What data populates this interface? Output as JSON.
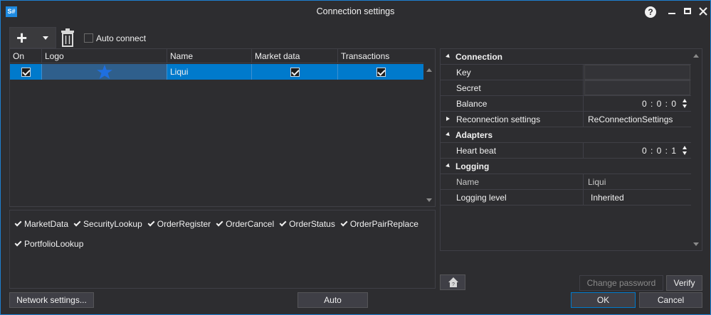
{
  "window": {
    "title": "Connection settings",
    "app_icon_text": "S#"
  },
  "toolbar": {
    "add_icon": "plus-icon",
    "dropdown_icon": "caret-down-icon",
    "delete_icon": "trash-icon",
    "auto_connect_label": "Auto connect",
    "auto_connect_checked": false
  },
  "grid": {
    "columns": [
      "On",
      "Logo",
      "Name",
      "Market data",
      "Transactions"
    ],
    "rows": [
      {
        "on": true,
        "logo_icon": "star-icon",
        "name": "Liqui",
        "market_data": true,
        "transactions": true
      }
    ],
    "selected_color": "#007acc"
  },
  "capabilities": [
    "MarketData",
    "SecurityLookup",
    "OrderRegister",
    "OrderCancel",
    "OrderStatus",
    "OrderPairReplace",
    "PortfolioLookup"
  ],
  "properties": {
    "connection": {
      "label": "Connection",
      "key_label": "Key",
      "key_value": "",
      "secret_label": "Secret",
      "secret_value": "",
      "balance_label": "Balance",
      "balance_value": "0 : 0 : 0",
      "reconnection_label": "Reconnection settings",
      "reconnection_value": "ReConnectionSettings"
    },
    "adapters": {
      "label": "Adapters",
      "heartbeat_label": "Heart beat",
      "heartbeat_value": "0 : 0 : 1"
    },
    "logging": {
      "label": "Logging",
      "name_label": "Name",
      "name_value": "Liqui",
      "level_label": "Logging level",
      "level_value": "Inherited"
    }
  },
  "buttons": {
    "network_settings": "Network settings...",
    "auto": "Auto",
    "change_password": "Change password",
    "verify": "Verify",
    "ok": "OK",
    "cancel": "Cancel"
  },
  "accent": "#007acc"
}
